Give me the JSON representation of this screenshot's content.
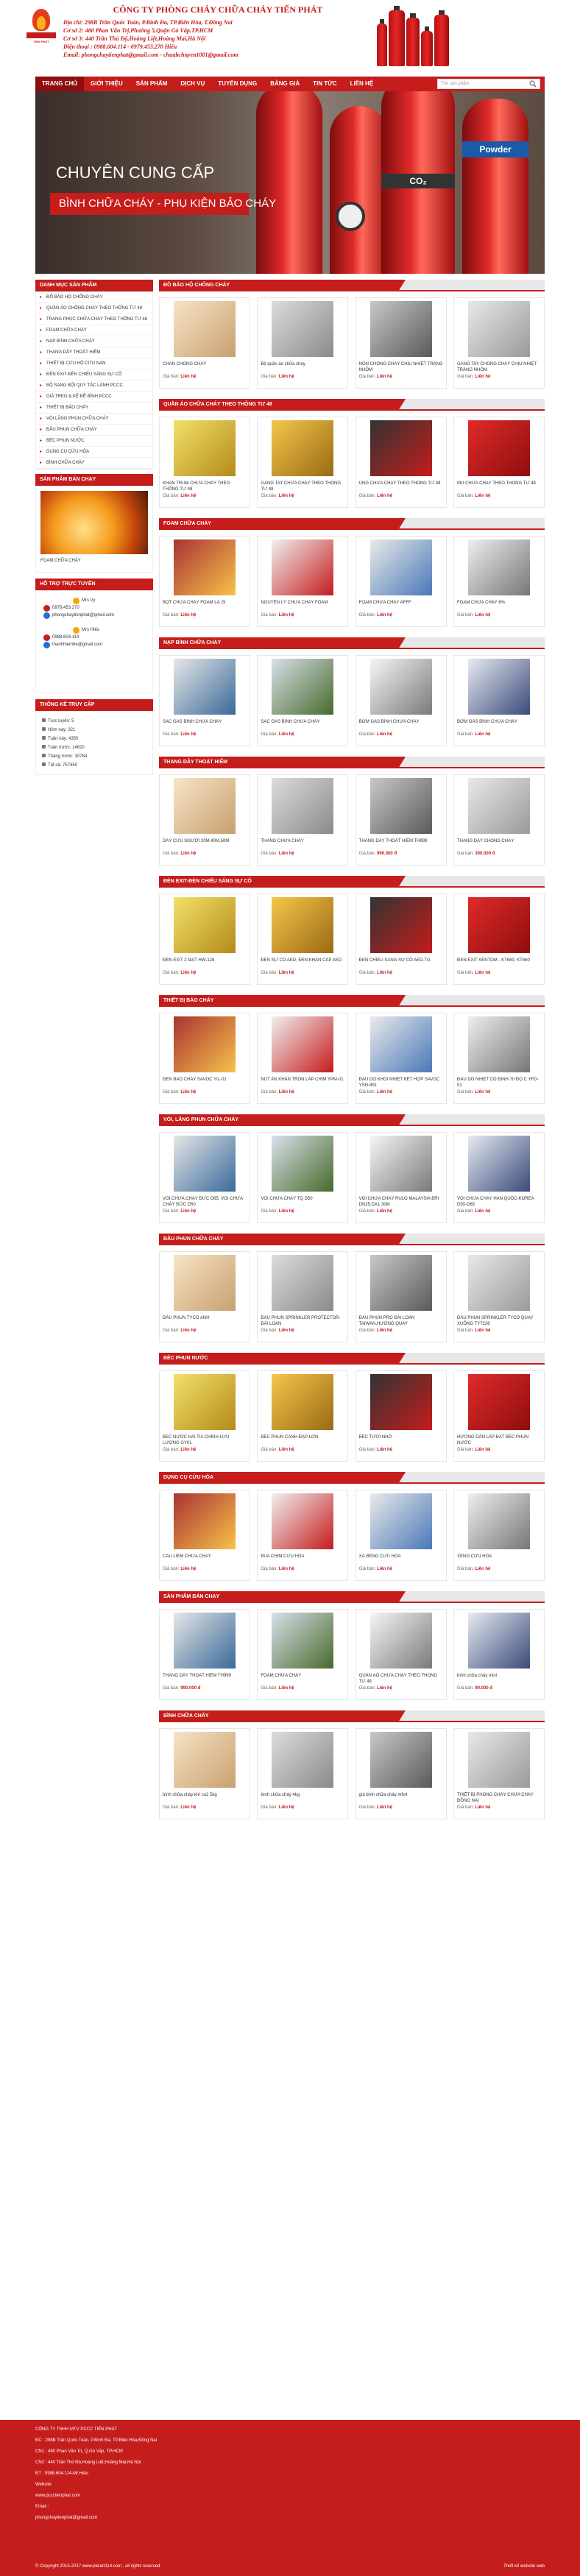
{
  "header": {
    "logo_text": "TIẾN PHÁT",
    "company_name": "CÔNG TY PHÒNG CHÁY CHỮA CHÁY TIẾN PHÁT",
    "lines": [
      "Địa chỉ:  298B Trần Quốc Toản, P.Bình Đa, TP.Biên Hòa, T.Đồng Nai",
      "Cơ sở 2:  480 Phan Văn Trị,Phường 5,Quận Gò Vấp,TP.HCM",
      "Cơ sở 3: 440 Trần Thủ Độ,Hoàng Liệt,Hoàng Mai,Hà Nội",
      "Điện thoại : 0988.604.114 - 0979.453.270 Hiếu",
      "Email: phongchaytienphat@gmail.com - chuabchuyen1001@gmail.com"
    ]
  },
  "nav": {
    "items": [
      "TRANG CHỦ",
      "GIỚI THIỆU",
      "SẢN PHẨM",
      "DỊCH VỤ",
      "TUYỂN DỤNG",
      "TIN TỨC",
      "BẢNG GIÁ",
      "TIN TỨC",
      "LIÊN HỆ"
    ],
    "search_placeholder": "Tìm sản phẩm"
  },
  "banner": {
    "line1": "CHUYÊN CUNG CẤP",
    "line2": "BÌNH CHỮA CHÁY - PHỤ KIỆN BẢO CHÁY",
    "label1": "Powder",
    "label2": "CO₂"
  },
  "sidebar": {
    "categories_title": "DANH MỤC SẢN PHẨM",
    "categories": [
      "ĐỒ BẢO HỘ CHỐNG CHÁY",
      "QUẦN ÁO CHỐNG CHÁY THEO THÔNG TƯ 48",
      "TRANG PHỤC CHỮA CHÁY THEO THÔNG TƯ 48",
      "FOAM CHỮA CHÁY",
      "NẠP BÌNH CHỮA CHÁY",
      "THANG DÂY THOÁT HIỂM",
      "THIẾT BỊ CỨU HỘ CỨU NẠN",
      "ĐÈN EXIT-ĐÈN CHIẾU SÁNG SỰ CỐ",
      "BỘ SẠNG BỘI QUY TẤC LÀNH PCCC",
      "GIÁ TREO & KỆ ĐỂ BÌNH PCCC",
      "THIẾT BỊ BÁO CHÁY",
      "VÒI LĂNG PHUN CHỮA CHÁY",
      "ĐẦU PHUN CHỮA CHÁY",
      "BÉC PHUN NƯỚC",
      "DỤNG CỤ CỨU HỎA",
      "BÌNH CHỮA CHÁY"
    ],
    "featured_title": "SẢN PHẨM BÁN CHẠY",
    "featured_name": "FOAM CHỮA CHÁY",
    "support_title": "HỖ TRỢ TRỰC TUYẾN",
    "support": [
      "Mrs Vy",
      "0979.453.270",
      "phongchaytienphat@gmail.com",
      "Mrs Hiếu",
      "0988.604.114",
      "thanhhiemhe@gmail.com"
    ],
    "stats_title": "THỐNG KÊ TRUY CẬP",
    "stats": [
      "Trực tuyến:  5",
      "Hôm nay:  321",
      "Tuần này:  4350",
      "Tuần trước:  14620",
      "Tháng trước:  30784",
      "Tất cả:  757450"
    ]
  },
  "sections": [
    {
      "title": "ĐỒ BẢO HỘ CHỐNG CHÁY",
      "items": [
        {
          "name": "CHĂN CHỐNG CHÁY",
          "price": "Liên hệ"
        },
        {
          "name": "Bộ quần áo chữa cháy",
          "price": "Liên hệ"
        },
        {
          "name": "NÓN CHỐNG CHÁY CHỊU NHIỆT TRÁNG NHÔM",
          "price": "Liên hệ"
        },
        {
          "name": "GĂNG TAY CHỐNG CHÁY CHỊU NHIỆT TRÁNG NHÔM",
          "price": "Liên hệ"
        }
      ]
    },
    {
      "title": "QUẦN ÁO CHỮA CHÁY THEO THÔNG TƯ 48",
      "items": [
        {
          "name": "KHĂN TRÙM CHỮA CHÁY THEO THÔNG TƯ 48",
          "price": "Liên hệ"
        },
        {
          "name": "GĂNG TAY CHỮA CHÁY THEO THÔNG TƯ 48",
          "price": "Liên hệ"
        },
        {
          "name": "ỦNG CHỮA CHÁY THEO THÔNG TƯ 48",
          "price": "Liên hệ"
        },
        {
          "name": "MŨ CHỮA CHÁY THEO THÔNG TƯ 48",
          "price": "Liên hệ"
        }
      ]
    },
    {
      "title": "FOAM CHỮA CHÁY",
      "items": [
        {
          "name": "BỌT CHỮA CHÁY FOAM LÀ GÌ",
          "price": "Liên hệ"
        },
        {
          "name": "NGUYÊN LÝ CHỮA CHÁY FOAM",
          "price": "Liên hệ"
        },
        {
          "name": "FOAM CHỮA CHÁY AFFF",
          "price": "Liên hệ"
        },
        {
          "name": "FOAM CHỮA CHÁY 6%",
          "price": "Liên hệ"
        }
      ]
    },
    {
      "title": "NẠP BÌNH CHỮA CHÁY",
      "items": [
        {
          "name": "SẠC GAS BÌNH CHỮA CHÁY",
          "price": "Liên hệ"
        },
        {
          "name": "SẠC GAS BÌNH CHỮA CHÁY",
          "price": "Liên hệ"
        },
        {
          "name": "BƠM GAS BÌNH CHỮA CHÁY",
          "price": "Liên hệ"
        },
        {
          "name": "BƠM GAS BÌNH CHỮA CHÁY",
          "price": "Liên hệ"
        }
      ]
    },
    {
      "title": "THANG DÂY THOÁT HIỂM",
      "items": [
        {
          "name": "DÂY CỨU NGƯỜI 20M,40M,50M",
          "price": "Liên hệ"
        },
        {
          "name": "THANG CHỮA CHÁY",
          "price": "Liên hệ"
        },
        {
          "name": "THANG DÂY THOÁT HIỂM TH999",
          "price": "990.000 đ"
        },
        {
          "name": "THANG DÂY CHỐNG CHÁY",
          "price": "300.000 đ"
        }
      ]
    },
    {
      "title": "ĐÈN EXIT-ĐÈN CHIẾU SÁNG SỰ CỐ",
      "items": [
        {
          "name": "ĐÈN EXIT 2 MẶT HW-128",
          "price": "Liên hệ"
        },
        {
          "name": "ĐÈN SỰ CỐ AED, ĐÈN KHẨN CẤP AED",
          "price": "Liên hệ"
        },
        {
          "name": "ĐÈN CHIẾU SÁNG SỰ CỐ AED-TG",
          "price": "Liên hệ"
        },
        {
          "name": "ĐÈN EXIT KENTOM - KT680, KT660",
          "price": "Liên hệ"
        }
      ]
    },
    {
      "title": "THIẾT BỊ BÁO CHÁY",
      "items": [
        {
          "name": "ĐÈN BÁO CHÁY SAVOC YIL-01",
          "price": "Liên hệ"
        },
        {
          "name": "NÚT ẤN KHẨN TRÒN LẮP CHÌM YPM-01",
          "price": "Liên hệ"
        },
        {
          "name": "ĐẦU DÒ KHÓI NHIỆT KẾT HỢP SAVOC YSH-891",
          "price": "Liên hệ"
        },
        {
          "name": "ĐẦU DÒ NHIỆT CỐ ĐỊNH 70 ĐỘ C YFD-01",
          "price": "Liên hệ"
        }
      ]
    },
    {
      "title": "VÒI, LĂNG PHUN CHỮA CHÁY",
      "items": [
        {
          "name": "VÒI CHỮA CHÁY ĐỨC D65, VÒI CHỮA CHÁY ĐỨC D50",
          "price": "Liên hệ"
        },
        {
          "name": "VÒI CHỮA CHÁY TQ D50",
          "price": "Liên hệ"
        },
        {
          "name": "VÒI CHỮA CHÁY RULO MALAYSIA BRI DN25,DA1 30M",
          "price": "Liên hệ"
        },
        {
          "name": "VÒI CHỮA CHÁY HÀN QUỐC-KOREA D50-D65",
          "price": "Liên hệ"
        }
      ]
    },
    {
      "title": "ĐẦU PHUN CHỮA CHÁY",
      "items": [
        {
          "name": "ĐẦU PHUN TYCO ANH",
          "price": "Liên hệ"
        },
        {
          "name": "ĐẦU PHUN SPRINKLER PROTECTOR-ĐÀI LOAN",
          "price": "Liên hệ"
        },
        {
          "name": "ĐẦU PHUN PRO ĐÀI LOAN TAIWAN,HƯỚNG QUAY",
          "price": "Liên hệ"
        },
        {
          "name": "ĐẦU PHUN SPRINKLER TYCO QUAY XUỐNG TY7226",
          "price": "Liên hệ"
        }
      ]
    },
    {
      "title": "BÉC PHUN NƯỚC",
      "items": [
        {
          "name": "BÉC NƯỚC HAI TIA CHỈNH LƯU LƯỢNG GY01",
          "price": "Liên hệ"
        },
        {
          "name": "BÉC PHUN CÁNH ĐẬP LỚN",
          "price": "Liên hệ"
        },
        {
          "name": "BÉC TƯỚI NHỎ",
          "price": "Liên hệ"
        },
        {
          "name": "HƯỚNG DẪN LẮP ĐẶT BÉC PHUN NƯỚC",
          "price": "Liên hệ"
        }
      ]
    },
    {
      "title": "DỤNG CỤ CỨU HỎA",
      "items": [
        {
          "name": "CÂU LIÊM CHỮA CHÁY",
          "price": "Liên hệ"
        },
        {
          "name": "BÚA CHIM CỨU HỎA",
          "price": "Liên hệ"
        },
        {
          "name": "XÀ BENG CỨU HỎA",
          "price": "Liên hệ"
        },
        {
          "name": "XẺNG CỨU HỎA",
          "price": "Liên hệ"
        }
      ]
    },
    {
      "title": "SẢN PHẨM BÁN CHẠY",
      "items": [
        {
          "name": "THANG DÂY THOÁT HIỂM TH999",
          "price": "990.000 đ"
        },
        {
          "name": "FOAM CHỮA CHÁY",
          "price": "Liên hệ"
        },
        {
          "name": "QUẦN ÁO CHỮA CHÁY THEO THÔNG TƯ 48",
          "price": "Liên hệ"
        },
        {
          "name": "bình chữa cháy mini",
          "price": "90.000 đ"
        }
      ]
    },
    {
      "title": "BÌNH CHỮA CHÁY",
      "items": [
        {
          "name": "bình chữa cháy khí co2 5kg",
          "price": "Liên hệ"
        },
        {
          "name": "bình chữa cháy 4kg",
          "price": "Liên hệ"
        },
        {
          "name": "giá bình chữa cháy mfz4",
          "price": "Liên hệ"
        },
        {
          "name": "THIẾT BỊ PHÒNG CHÁY CHỮA CHÁY ĐỒNG NAI",
          "price": "Liên hệ"
        }
      ]
    }
  ],
  "price_label": "Giá bán:",
  "footer": {
    "lines": [
      "CÔNG TY TNHH MTV PCCC TIẾN PHÁT",
      "ĐC : 298B Trần Quốc Toản, P.Bình Đa, TP.Biên Hòa,Đồng Nai",
      "CN1 : 480 Phan Văn Trị, Q.Gò Vấp, TP.HCM",
      "CN2 : 440 Trần Thủ Độ,Hoàng Liệt,Hoàng Mai,Hà Nội",
      "ĐT : 0988.604.114-Mr.Hiếu",
      "Website:",
      "www.pccctienphat.com",
      "Email :",
      "phongchaytienphat@gmail.com"
    ],
    "copyright": "© Copyright 2015-2017 www.pleiart114.com , all rights reserved",
    "credit": "Thiết kế website web"
  },
  "colors": {
    "primary": "#c51c1c",
    "nav_active": "#8e0e0e"
  }
}
